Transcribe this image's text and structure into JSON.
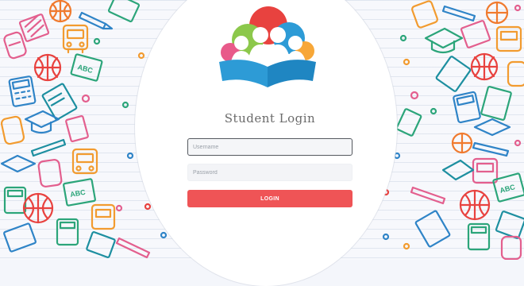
{
  "page": {
    "title": "Student Login"
  },
  "form": {
    "username_placeholder": "Username",
    "password_placeholder": "Password",
    "login_label": "LOGIN"
  },
  "logo": {
    "icon": "students-reading-book-icon",
    "colors": [
      "#e8423f",
      "#8cc84b",
      "#2d9bd6",
      "#f7a738",
      "#e85a8a"
    ]
  },
  "background": {
    "icons": [
      "school-bus-icon",
      "backpack-icon",
      "basketball-icon",
      "calculator-icon",
      "notebook-icon",
      "chalkboard-abc-icon",
      "graduation-cap-icon",
      "pencil-icon",
      "book-icon"
    ],
    "accent": "#ef5456"
  }
}
